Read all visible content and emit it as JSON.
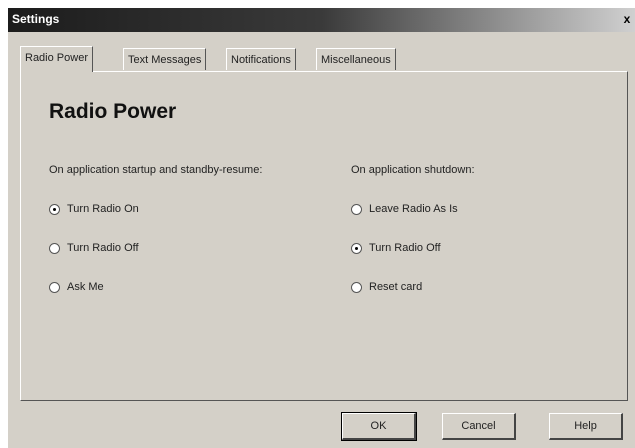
{
  "window": {
    "title": "Settings",
    "close_glyph": "x"
  },
  "tabs": [
    {
      "label": "Radio Power",
      "active": true
    },
    {
      "label": "Text Messages",
      "active": false
    },
    {
      "label": "Notifications",
      "active": false
    },
    {
      "label": "Miscellaneous",
      "active": false
    }
  ],
  "panel": {
    "heading": "Radio Power",
    "startup": {
      "caption": "On application startup and standby-resume:",
      "options": [
        {
          "label": "Turn Radio On",
          "checked": true
        },
        {
          "label": "Turn Radio Off",
          "checked": false
        },
        {
          "label": "Ask Me",
          "checked": false
        }
      ]
    },
    "shutdown": {
      "caption": "On application shutdown:",
      "options": [
        {
          "label": "Leave Radio As Is",
          "checked": false
        },
        {
          "label": "Turn Radio Off",
          "checked": true
        },
        {
          "label": "Reset card",
          "checked": false
        }
      ]
    }
  },
  "buttons": {
    "ok": "OK",
    "cancel": "Cancel",
    "help": "Help"
  }
}
